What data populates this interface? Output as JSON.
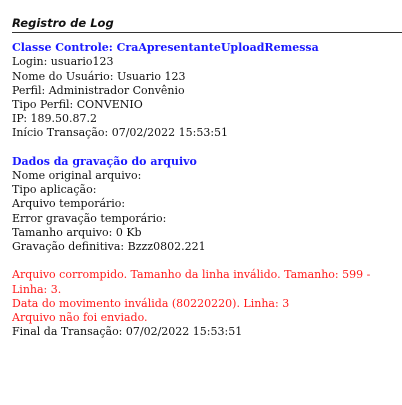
{
  "title": "Registro de Log",
  "controle": {
    "heading": "Classe Controle: CraApresentanteUploadRemessa",
    "lines": [
      "Login: usuario123",
      "Nome do Usuário: Usuario 123",
      "Perfil: Administrador Convênio",
      "Tipo Perfil: CONVENIO",
      "IP: 189.50.87.2",
      "Início Transação: 07/02/2022 15:53:51"
    ]
  },
  "arquivo": {
    "heading": "Dados da gravação do arquivo",
    "lines": [
      "Nome original arquivo:",
      "Tipo aplicação:",
      "Arquivo temporário:",
      "Error gravação temporário:",
      "Tamanho arquivo: 0 Kb",
      "Gravação definitiva: Bzzz0802.221"
    ]
  },
  "errors": [
    "Arquivo corrompido. Tamanho da linha inválido. Tamanho: 599 - Linha: 3.",
    "Data do movimento inválida (80220220). Linha: 3",
    "Arquivo não foi enviado."
  ],
  "final": "Final da Transação: 07/02/2022 15:53:51"
}
